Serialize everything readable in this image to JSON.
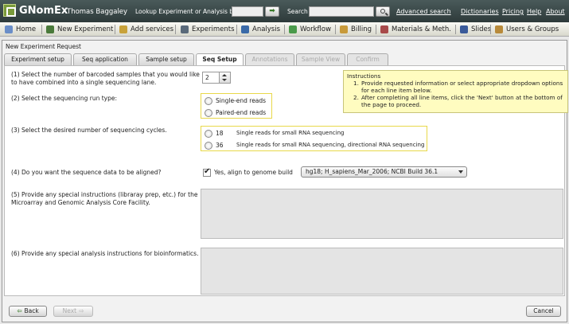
{
  "app": {
    "logo_text": "GNomEx",
    "user": "Thomas Baggaley",
    "lookup_label": "Lookup Experiment or Analysis by #",
    "lookup_value": "",
    "go_icon": "right-arrow-icon",
    "search_label": "Search",
    "search_value": "",
    "links": [
      "Advanced search",
      "Dictionaries",
      "Pricing",
      "Help",
      "About"
    ]
  },
  "menu": [
    {
      "label": "Home",
      "icon": "home-icon",
      "color": "#6a8ec8"
    },
    {
      "label": "New Experiment",
      "icon": "flask-icon",
      "color": "#4a7a3a"
    },
    {
      "label": "Add services",
      "icon": "services-icon",
      "color": "#c8a23a"
    },
    {
      "label": "Experiments",
      "icon": "experiments-icon",
      "color": "#5a6a7a"
    },
    {
      "label": "Analysis",
      "icon": "analysis-icon",
      "color": "#3a6aa8"
    },
    {
      "label": "Workflow",
      "icon": "workflow-icon",
      "color": "#4a9a4a"
    },
    {
      "label": "Billing",
      "icon": "billing-icon",
      "color": "#c89a3a"
    },
    {
      "label": "Materials & Meth.",
      "icon": "materials-icon",
      "color": "#a84a4a"
    },
    {
      "label": "Slides",
      "icon": "slides-icon",
      "color": "#3a5a9a"
    },
    {
      "label": "Users & Groups",
      "icon": "users-icon",
      "color": "#b88a3a"
    }
  ],
  "panel": {
    "title": "New Experiment Request",
    "tabs": [
      {
        "label": "Experiment setup",
        "state": "normal"
      },
      {
        "label": "Seq application",
        "state": "normal"
      },
      {
        "label": "Sample setup",
        "state": "normal"
      },
      {
        "label": "Seq Setup",
        "state": "active"
      },
      {
        "label": "Annotations",
        "state": "disabled"
      },
      {
        "label": "Sample View",
        "state": "disabled"
      },
      {
        "label": "Confirm",
        "state": "disabled"
      }
    ]
  },
  "form": {
    "q1": "(1) Select the number of barcoded samples that you would like to have combined into a single sequencing lane.",
    "q1_value": "2",
    "q2": "(2) Select the sequencing run type:",
    "run_types": [
      "Single-end reads",
      "Paired-end reads"
    ],
    "q3": "(3) Select the desired number of sequencing cycles.",
    "cycles": [
      {
        "num": "18",
        "desc": "Single reads for small RNA sequencing"
      },
      {
        "num": "36",
        "desc": "Single reads for small RNA sequencing, directional RNA sequencing"
      }
    ],
    "q4": "(4) Do you want the sequence data to be aligned?",
    "align_label": "Yes, align to genome build",
    "align_checked": true,
    "genome_build": "hg18; H_sapiens_Mar_2006; NCBI Build 36.1",
    "q5": "(5) Provide any special instructions (libraray prep, etc.) for the Microarray and Genomic Analysis Core Facility.",
    "q5_value": "",
    "q6": "(6) Provide any special analysis instructions for bioinformatics.",
    "q6_value": ""
  },
  "instructions": {
    "title": "Instructions",
    "steps": [
      {
        "n": "1.",
        "text": "Provide requested information or select appropriate dropdown options for each line item below."
      },
      {
        "n": "2.",
        "text": "After completing all line items, click the 'Next' button at the bottom of the page to proceed."
      }
    ]
  },
  "buttons": {
    "back": "Back",
    "next": "Next",
    "cancel": "Cancel"
  }
}
